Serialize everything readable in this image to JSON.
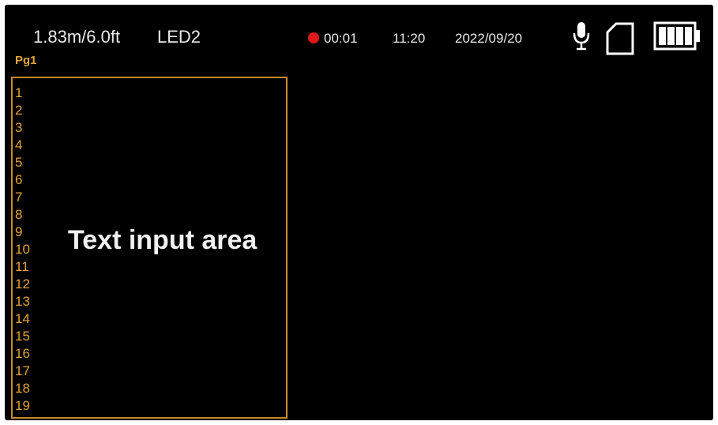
{
  "status_bar": {
    "distance": "1.83m/6.0ft",
    "led": "LED2",
    "recording_time": "00:01",
    "clock": "11:20",
    "date": "2022/09/20"
  },
  "page_label": "Pg1",
  "text_area": {
    "placeholder": "Text input area",
    "line_numbers": [
      "1",
      "2",
      "3",
      "4",
      "5",
      "6",
      "7",
      "8",
      "9",
      "10",
      "11",
      "12",
      "13",
      "14",
      "15",
      "16",
      "17",
      "18",
      "19"
    ]
  },
  "icons": {
    "recording": "record-dot-icon",
    "microphone": "microphone-icon",
    "storage": "sd-card-icon",
    "battery": "battery-icon"
  },
  "colors": {
    "background": "#000000",
    "accent": "#e3a436",
    "text_area_border": "#c8882a",
    "recording": "#e01818",
    "status_text": "#e8e8e8"
  },
  "battery_level": 1.0
}
